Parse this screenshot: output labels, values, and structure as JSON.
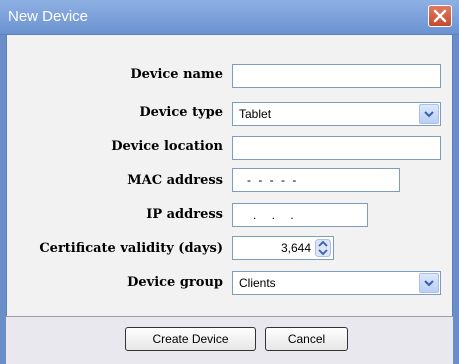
{
  "window": {
    "title": "New Device"
  },
  "form": {
    "device_name": {
      "label": "Device name",
      "value": ""
    },
    "device_type": {
      "label": "Device type",
      "value": "Tablet"
    },
    "device_location": {
      "label": "Device location",
      "value": ""
    },
    "mac_address": {
      "label": "MAC address",
      "value": "- - - - -"
    },
    "ip_address": {
      "label": "IP address",
      "value": ". . ."
    },
    "cert_validity": {
      "label": "Certificate validity (days)",
      "value": "3,644"
    },
    "device_group": {
      "label": "Device group",
      "value": "Clients"
    }
  },
  "buttons": {
    "create": "Create Device",
    "cancel": "Cancel"
  },
  "colors": {
    "titlebar": "#7aa0db",
    "close": "#d35a3a",
    "body": "#f2f2f2"
  }
}
